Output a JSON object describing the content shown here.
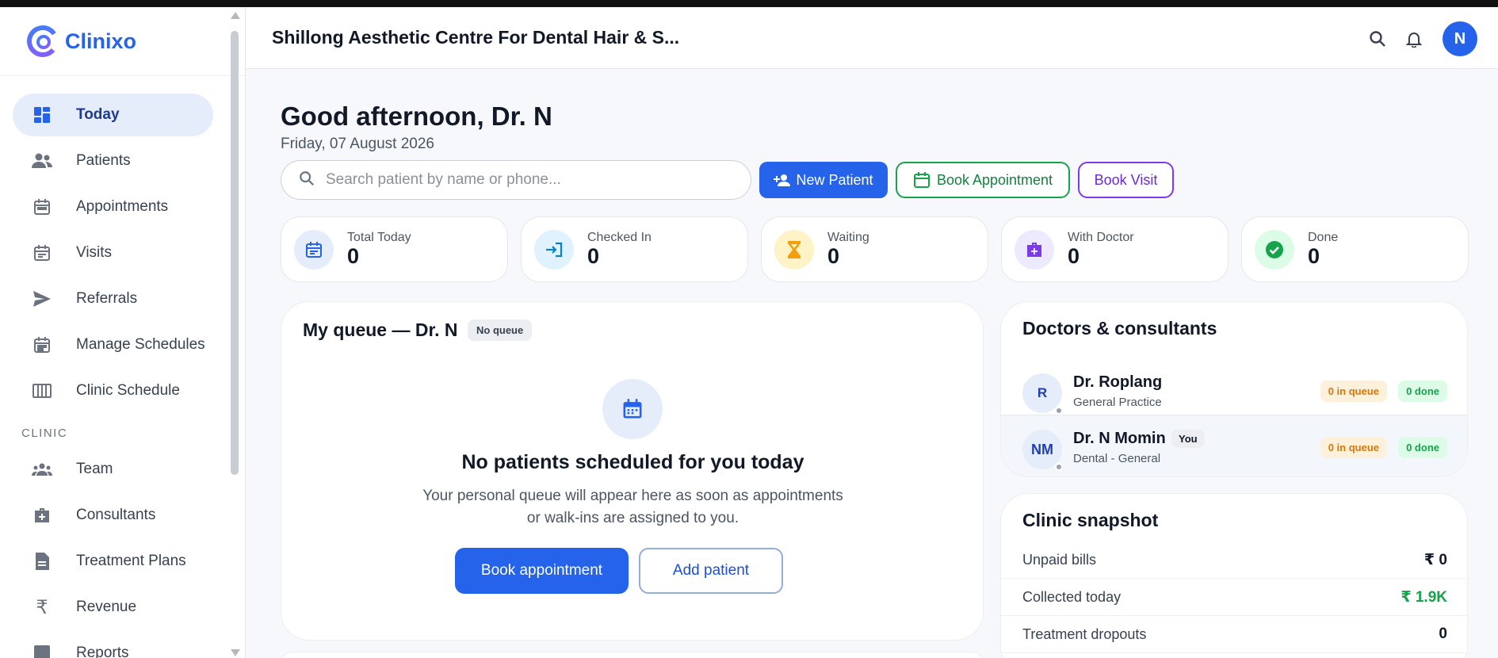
{
  "brand": {
    "name": "Clinixo",
    "accent": "#2563eb"
  },
  "sidebar": {
    "items": [
      {
        "label": "Today",
        "icon": "dashboard-icon",
        "active": true
      },
      {
        "label": "Patients",
        "icon": "people-icon"
      },
      {
        "label": "Appointments",
        "icon": "calendar-icon"
      },
      {
        "label": "Visits",
        "icon": "visit-calendar-icon"
      },
      {
        "label": "Referrals",
        "icon": "send-icon"
      },
      {
        "label": "Manage Schedules",
        "icon": "schedule-calendar-icon"
      },
      {
        "label": "Clinic Schedule",
        "icon": "columns-icon"
      }
    ],
    "section_label": "CLINIC",
    "clinic_items": [
      {
        "label": "Team",
        "icon": "team-icon"
      },
      {
        "label": "Consultants",
        "icon": "medical-bag-icon"
      },
      {
        "label": "Treatment Plans",
        "icon": "document-icon"
      },
      {
        "label": "Revenue",
        "icon": "rupee-icon"
      },
      {
        "label": "Reports",
        "icon": "reports-icon"
      }
    ]
  },
  "header": {
    "clinic_name": "Shillong Aesthetic Centre For Dental Hair & S...",
    "avatar_initial": "N"
  },
  "main": {
    "greeting": "Good afternoon, Dr. N",
    "date": "Friday, 07 August 2026",
    "search_placeholder": "Search patient by name or phone...",
    "buttons": {
      "new_patient": "New Patient",
      "book_appointment": "Book Appointment",
      "book_visit": "Book Visit"
    }
  },
  "stats": [
    {
      "label": "Total Today",
      "value": "0",
      "icon": "calendar-list-icon",
      "color": "#2563eb"
    },
    {
      "label": "Checked In",
      "value": "0",
      "icon": "login-arrow-icon",
      "color": "#0284c7"
    },
    {
      "label": "Waiting",
      "value": "0",
      "icon": "hourglass-icon",
      "color": "#f59e0b"
    },
    {
      "label": "With Doctor",
      "value": "0",
      "icon": "medical-bag-icon",
      "color": "#7c3aed"
    },
    {
      "label": "Done",
      "value": "0",
      "icon": "check-circle-icon",
      "color": "#16a34a"
    }
  ],
  "queue": {
    "title": "My queue — Dr. N",
    "badge": "No queue",
    "empty_title": "No patients scheduled for you today",
    "empty_line1": "Your personal queue will appear here as soon as appointments",
    "empty_line2": "or walk-ins are assigned to you.",
    "book_button": "Book appointment",
    "add_button": "Add patient"
  },
  "doctors": {
    "title": "Doctors & consultants",
    "list": [
      {
        "initials": "R",
        "name": "Dr. Roplang",
        "specialty": "General Practice",
        "queue": "0 in queue",
        "done": "0 done",
        "you": false
      },
      {
        "initials": "NM",
        "name": "Dr. N Momin",
        "specialty": "Dental - General",
        "queue": "0 in queue",
        "done": "0 done",
        "you": true,
        "you_label": "You"
      }
    ]
  },
  "snapshot": {
    "title": "Clinic snapshot",
    "rows": [
      {
        "label": "Unpaid bills",
        "value": "₹ 0"
      },
      {
        "label": "Collected today",
        "value": "₹ 1.9K",
        "highlight": "green"
      },
      {
        "label": "Treatment dropouts",
        "value": "0"
      }
    ]
  }
}
